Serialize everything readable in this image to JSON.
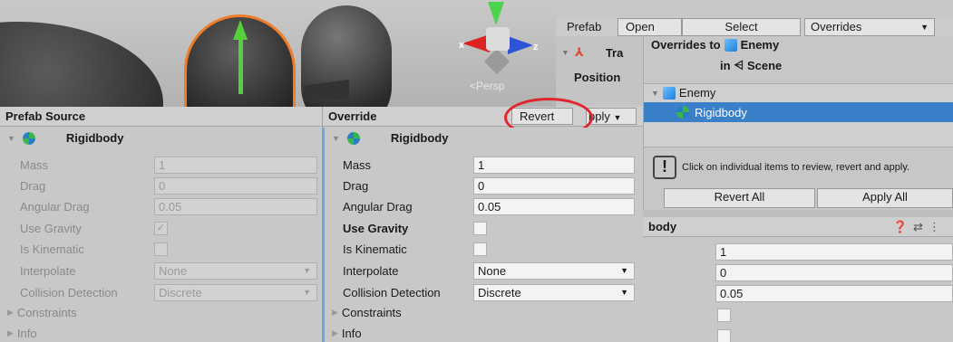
{
  "scene": {
    "axis_x": "x",
    "axis_z": "z",
    "projection": "Persp"
  },
  "prefab_bar": {
    "label": "Prefab",
    "open": "Open",
    "select": "Select",
    "overrides": "Overrides"
  },
  "transform": {
    "title": "Tra",
    "position": "Position"
  },
  "overrides_popup": {
    "title_prefix": "Overrides to",
    "prefab_name": "Enemy",
    "in_label": "in",
    "scene_label": "Scene",
    "tree_root": "Enemy",
    "tree_child": "Rigidbody",
    "info_text": "Click on individual items to review, revert and apply.",
    "revert_all": "Revert All",
    "apply_all": "Apply All"
  },
  "prefab_source": {
    "header": "Prefab Source",
    "component": "Rigidbody",
    "mass_label": "Mass",
    "mass": "1",
    "drag_label": "Drag",
    "drag": "0",
    "angular_drag_label": "Angular Drag",
    "angular_drag": "0.05",
    "use_gravity_label": "Use Gravity",
    "use_gravity_check": "✓",
    "is_kinematic_label": "Is Kinematic",
    "interpolate_label": "Interpolate",
    "interpolate": "None",
    "collision_label": "Collision Detection",
    "collision": "Discrete",
    "constraints": "Constraints",
    "info": "Info"
  },
  "override": {
    "header": "Override",
    "revert": "Revert",
    "apply": "pply",
    "component": "Rigidbody",
    "mass_label": "Mass",
    "mass": "1",
    "drag_label": "Drag",
    "drag": "0",
    "angular_drag_label": "Angular Drag",
    "angular_drag": "0.05",
    "use_gravity_label": "Use Gravity",
    "is_kinematic_label": "Is Kinematic",
    "interpolate_label": "Interpolate",
    "interpolate": "None",
    "collision_label": "Collision Detection",
    "collision": "Discrete",
    "constraints": "Constraints",
    "info": "Info"
  },
  "right_inspector": {
    "header": "body",
    "mass": "1",
    "drag": "0",
    "angular_drag": "0.05"
  },
  "colors": {
    "selection": "#3a80c9",
    "highlight_circle": "#e0262d",
    "override_bar": "#6aa7e0"
  }
}
